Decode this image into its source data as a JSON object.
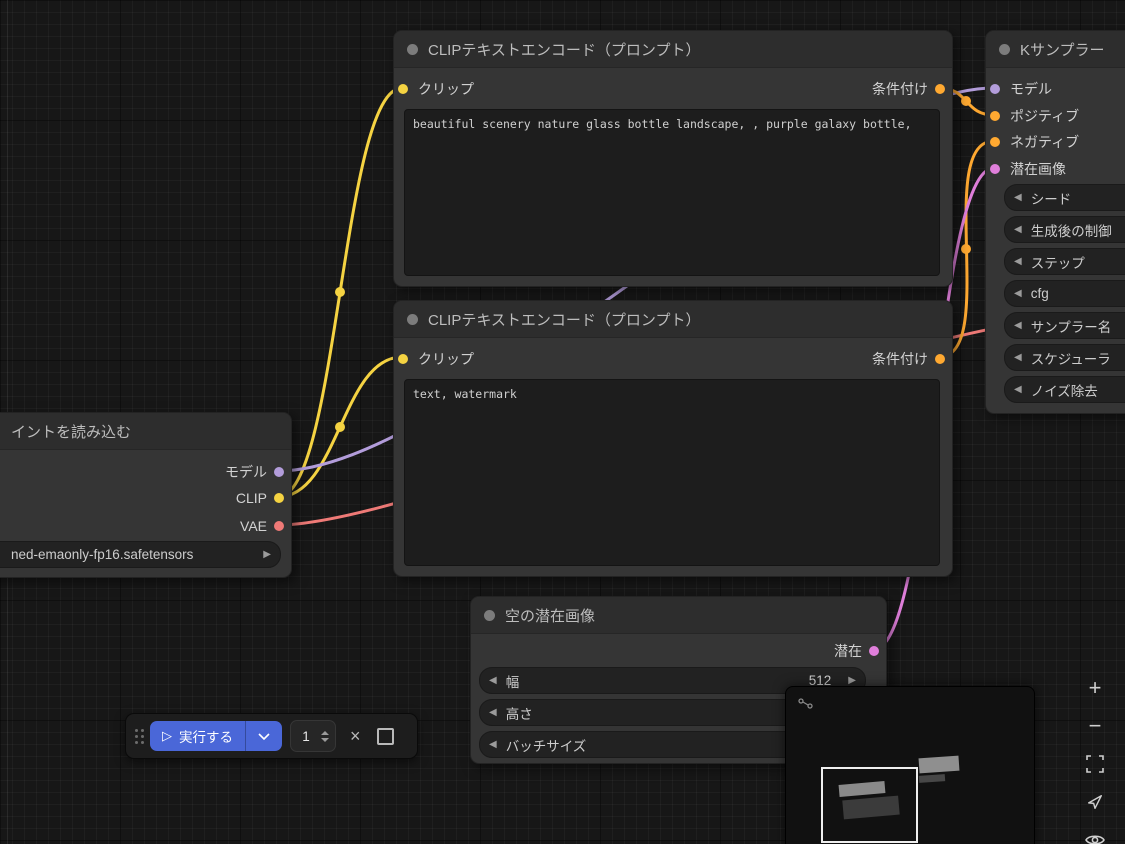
{
  "colors": {
    "model": "#b39ddb",
    "clip": "#f5d342",
    "vae": "#ef7a77",
    "conditioning": "#ffa931",
    "latent": "#e07fdb",
    "run_button_blue": "#4a67d8",
    "node_background": "#353535",
    "canvas_background": "#171717"
  },
  "icons": {
    "arrow_left": "◀",
    "arrow_right": "▶",
    "play": "▷",
    "close": "×",
    "zoom_in": "+",
    "zoom_out": "−"
  },
  "nodes": {
    "clip_encode_positive": {
      "title": "CLIPテキストエンコード（プロンプト）",
      "input": "クリップ",
      "output": "条件付け",
      "text": "beautiful scenery nature glass bottle landscape, , purple galaxy bottle,"
    },
    "clip_encode_negative": {
      "title": "CLIPテキストエンコード（プロンプト）",
      "input": "クリップ",
      "output": "条件付け",
      "text": "text, watermark"
    },
    "checkpoint_loader": {
      "title": "イントを読み込む",
      "outputs": [
        "モデル",
        "CLIP",
        "VAE"
      ],
      "ckpt_name": "ned-emaonly-fp16.safetensors"
    },
    "ksampler": {
      "title": "Kサンプラー",
      "inputs": [
        "モデル",
        "ポジティブ",
        "ネガティブ",
        "潜在画像"
      ],
      "widgets": [
        "シード",
        "生成後の制御",
        "ステップ",
        "cfg",
        "サンプラー名",
        "スケジューラ",
        "ノイズ除去"
      ]
    },
    "empty_latent": {
      "title": "空の潜在画像",
      "output": "潜在",
      "widgets": [
        {
          "label": "幅",
          "value": "512"
        },
        {
          "label": "高さ",
          "value": ""
        },
        {
          "label": "バッチサイズ",
          "value": ""
        }
      ]
    }
  },
  "runbar": {
    "run_label": "実行する",
    "count": "1"
  }
}
